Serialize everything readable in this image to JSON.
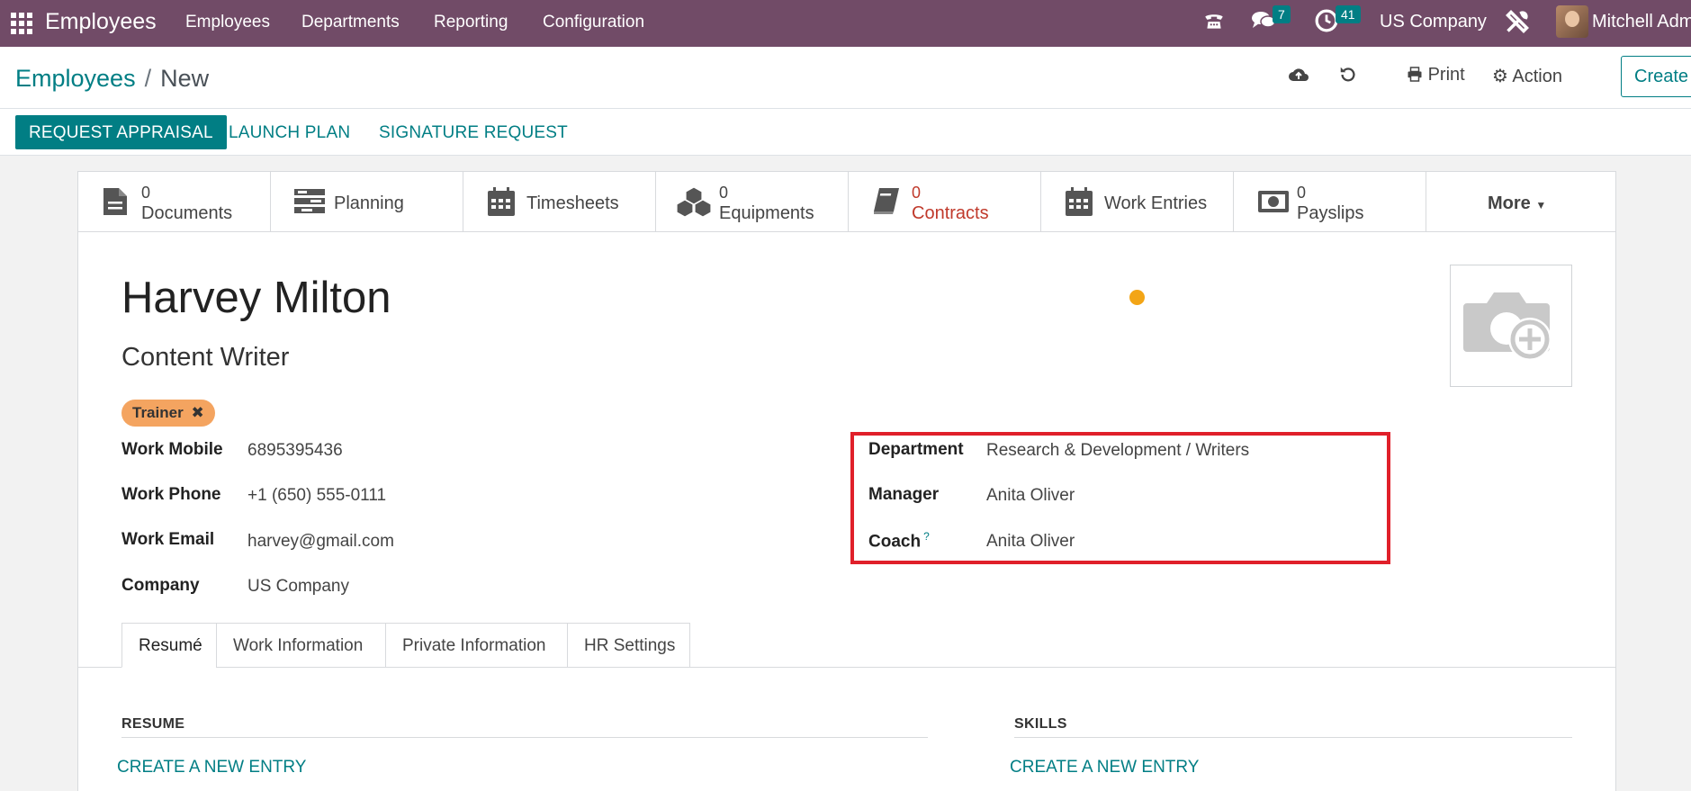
{
  "navbar": {
    "app_name": "Employees",
    "menus": [
      "Employees",
      "Departments",
      "Reporting",
      "Configuration"
    ],
    "messages_count": "7",
    "activities_count": "41",
    "company": "US Company",
    "user": "Mitchell Admin",
    "color": "#714b67"
  },
  "breadcrumb": {
    "parent": "Employees",
    "separator": "/",
    "current": "New"
  },
  "toolbar": {
    "print": "Print",
    "action": "Action",
    "create": "Create"
  },
  "statusbar": {
    "request_appraisal": "REQUEST APPRAISAL",
    "launch_plan": "LAUNCH PLAN",
    "signature_request": "SIGNATURE REQUEST"
  },
  "stats": {
    "documents": {
      "count": "0",
      "label": "Documents"
    },
    "planning": {
      "label": "Planning"
    },
    "timesheets": {
      "label": "Timesheets"
    },
    "equipments": {
      "count": "0",
      "label": "Equipments"
    },
    "contracts": {
      "count": "0",
      "label": "Contracts"
    },
    "work_entries": {
      "label": "Work Entries"
    },
    "payslips": {
      "count": "0",
      "label": "Payslips"
    },
    "more": "More"
  },
  "employee": {
    "name": "Harvey Milton",
    "job_title": "Content Writer",
    "tag": "Trainer",
    "fields": {
      "work_mobile": {
        "label": "Work Mobile",
        "value": "6895395436"
      },
      "work_phone": {
        "label": "Work Phone",
        "value": "+1 (650) 555-0111"
      },
      "work_email": {
        "label": "Work Email",
        "value": "harvey@gmail.com"
      },
      "company": {
        "label": "Company",
        "value": "US Company"
      },
      "department": {
        "label": "Department",
        "value": "Research & Development / Writers"
      },
      "manager": {
        "label": "Manager",
        "value": "Anita Oliver"
      },
      "coach": {
        "label": "Coach",
        "help": "?",
        "value": "Anita Oliver"
      }
    }
  },
  "tabs": [
    "Resumé",
    "Work Information",
    "Private Information",
    "HR Settings"
  ],
  "resume_section": {
    "title": "RESUME",
    "action": "CREATE A NEW ENTRY"
  },
  "skills_section": {
    "title": "SKILLS",
    "action": "CREATE A NEW ENTRY"
  },
  "colors": {
    "accent": "#017e84",
    "highlight": "#e0202a",
    "tag": "#f4a460",
    "status_dot": "#f3a516"
  }
}
